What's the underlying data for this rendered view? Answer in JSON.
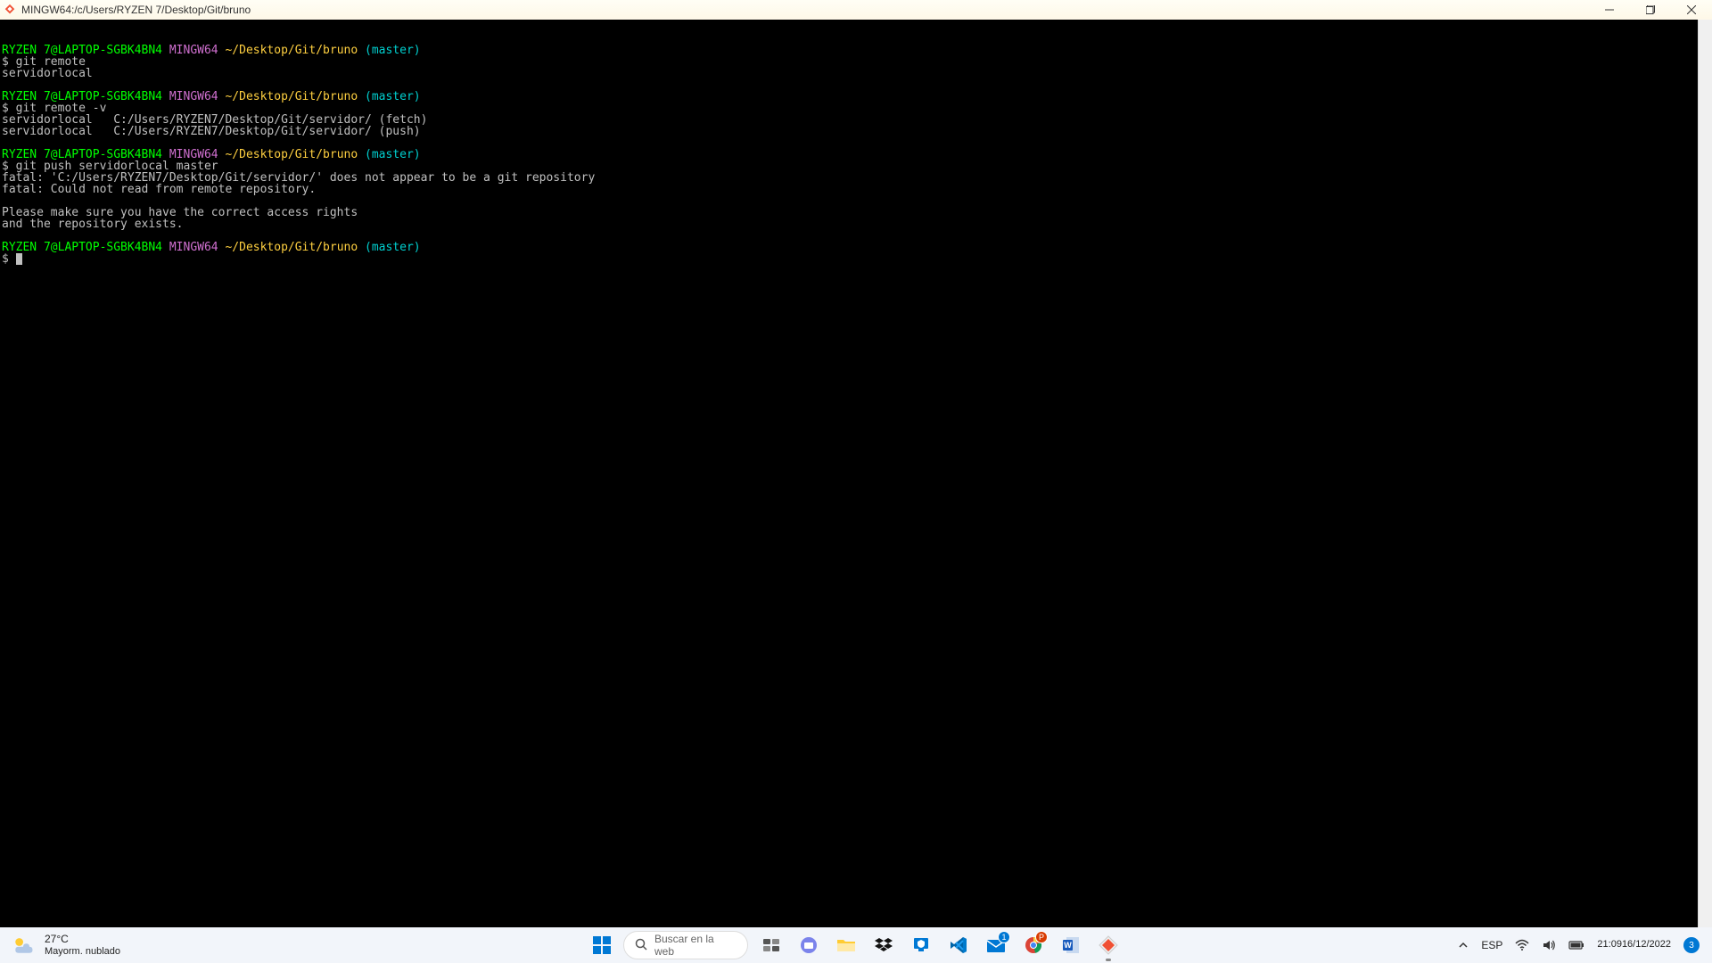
{
  "window": {
    "title": "MINGW64:/c/Users/RYZEN 7/Desktop/Git/bruno"
  },
  "prompt": {
    "user": "RYZEN 7@LAPTOP-SGBK4BN4",
    "host": "MINGW64",
    "path": "~/Desktop/Git/bruno",
    "branch": "(master)",
    "symbol": "$"
  },
  "blocks": [
    {
      "cmd": "git remote",
      "out": [
        "servidorlocal"
      ]
    },
    {
      "cmd": "git remote -v",
      "out": [
        "servidorlocal   C:/Users/RYZEN7/Desktop/Git/servidor/ (fetch)",
        "servidorlocal   C:/Users/RYZEN7/Desktop/Git/servidor/ (push)"
      ]
    },
    {
      "cmd": "git push servidorlocal master",
      "out": [
        "fatal: 'C:/Users/RYZEN7/Desktop/Git/servidor/' does not appear to be a git repository",
        "fatal: Could not read from remote repository.",
        "",
        "Please make sure you have the correct access rights",
        "and the repository exists."
      ]
    }
  ],
  "weather": {
    "temp": "27°C",
    "desc": "Mayorm. nublado"
  },
  "search": {
    "placeholder": "Buscar en la web"
  },
  "systray": {
    "lang": "ESP",
    "time": "21:09",
    "date": "16/12/2022",
    "notif_count": "3"
  }
}
